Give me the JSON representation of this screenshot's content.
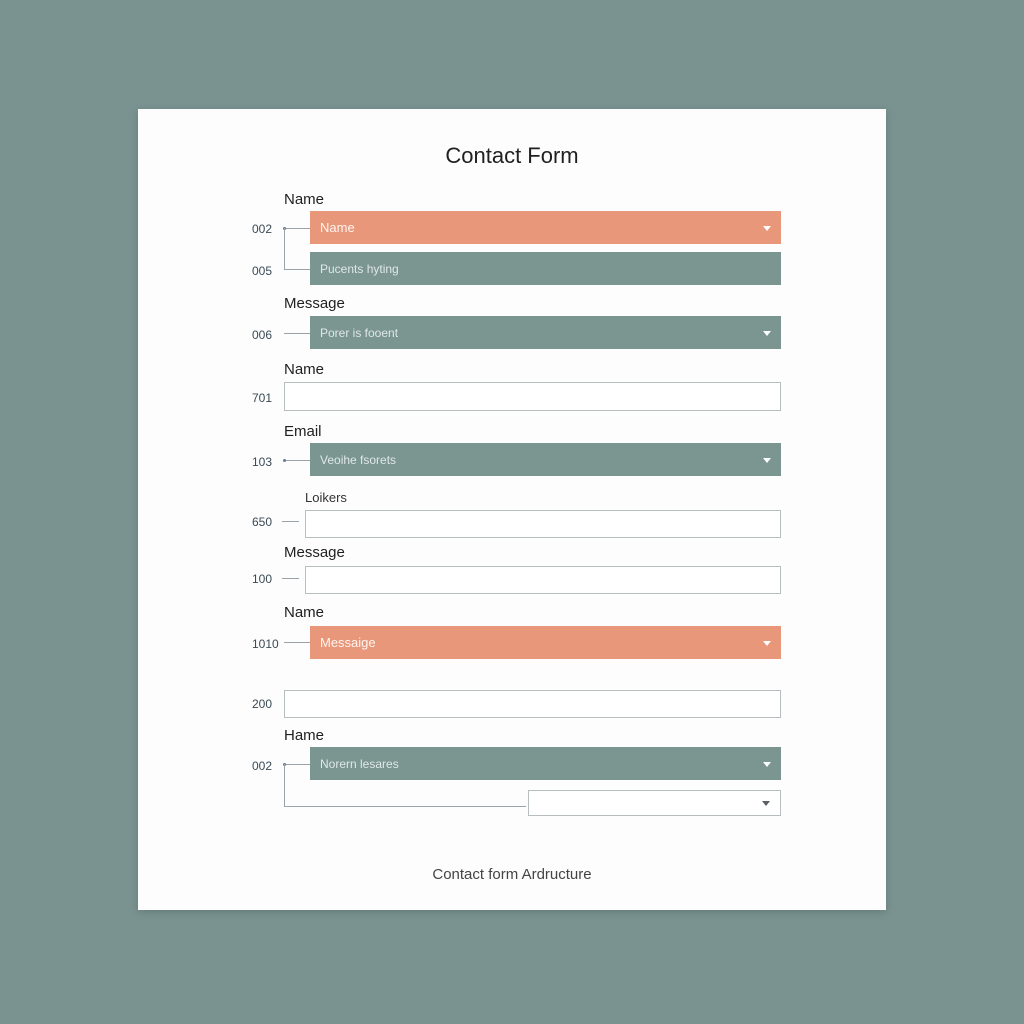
{
  "form": {
    "title": "Contact Form",
    "footer": "Contact form Ardructure"
  },
  "rows": {
    "r1": {
      "label": "Name",
      "num_a": "002",
      "field_a_text": "Name",
      "num_b": "005",
      "field_b_text": "Pucents hyting"
    },
    "r2": {
      "label": "Message",
      "num": "006",
      "field_text": "Porer is fooent"
    },
    "r3": {
      "label": "Name",
      "num": "701"
    },
    "r4": {
      "label": "Email",
      "num": "103",
      "field_text": "Veoihe fsorets"
    },
    "r5": {
      "label": "Loikers",
      "num": "650"
    },
    "r6": {
      "label": "Message",
      "num": "100"
    },
    "r7": {
      "label": "Name",
      "num": "1010",
      "field_text": "Messaige"
    },
    "r8": {
      "num": "200"
    },
    "r9": {
      "label": "Hame",
      "num": "002",
      "field_text": "Norern lesares"
    }
  },
  "colors": {
    "background": "#7a9391",
    "coral_field": "#e9977a",
    "slate_field": "#7b9591"
  },
  "icons": {
    "dropdown": "chevron-down-icon"
  }
}
